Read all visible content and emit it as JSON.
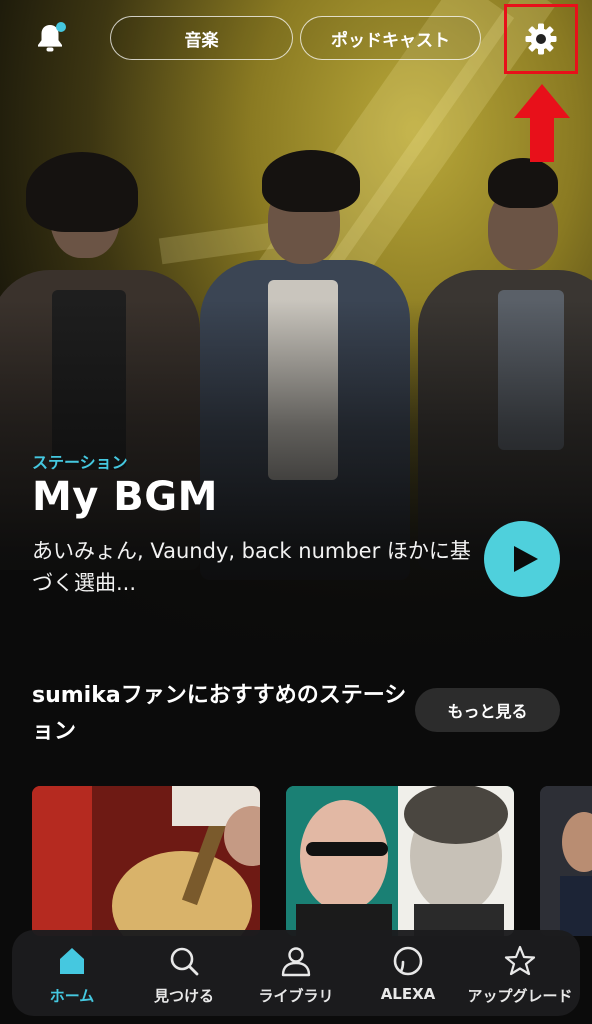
{
  "top_bar": {
    "music_tab": "音楽",
    "podcast_tab": "ポッドキャスト"
  },
  "hero": {
    "label": "ステーション",
    "title": "My BGM",
    "description": "あいみょん, Vaundy, back number ほかに基づく選曲..."
  },
  "section": {
    "title": "sumikaファンにおすすめのステーション",
    "more_button": "もっと見る"
  },
  "bottom_nav": {
    "items": [
      {
        "label": "ホーム",
        "icon": "home-icon",
        "active": true
      },
      {
        "label": "見つける",
        "icon": "search-icon",
        "active": false
      },
      {
        "label": "ライブラリ",
        "icon": "person-icon",
        "active": false
      },
      {
        "label": "ALEXA",
        "icon": "alexa-icon",
        "active": false
      },
      {
        "label": "アップグレード",
        "icon": "star-icon",
        "active": false
      }
    ]
  },
  "colors": {
    "accent": "#45c8e0",
    "play_button": "#4fd0dc",
    "highlight": "#e8101a"
  }
}
